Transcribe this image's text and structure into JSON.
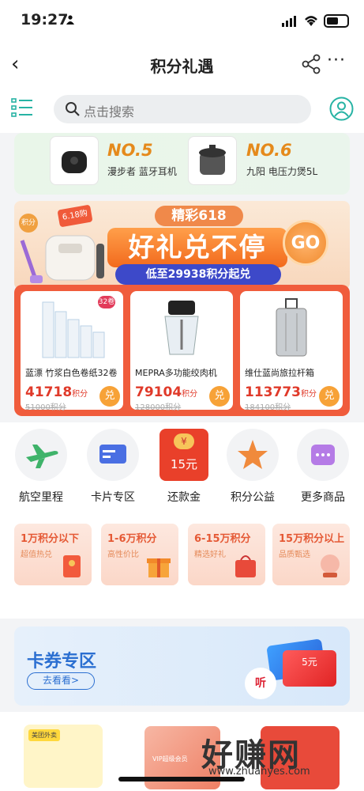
{
  "status": {
    "time": "19:27"
  },
  "nav": {
    "back": "‹",
    "title": "积分礼遇",
    "more": "···"
  },
  "search": {
    "placeholder": "点击搜索"
  },
  "top_products": [
    {
      "rank": "NO.5",
      "name": "漫步者 蓝牙耳机"
    },
    {
      "rank": "NO.6",
      "name": "九阳 电压力煲5L"
    }
  ],
  "banner": {
    "badge": "积分",
    "tag": "6.18购",
    "pill": "精彩618",
    "headline": "好礼兑不停",
    "sub": "低至29938积分起兑",
    "go": "GO"
  },
  "deals": [
    {
      "name": "蓝漂 竹浆白色卷纸32卷",
      "points": "41718",
      "unit": "积分",
      "old": "51000积分",
      "button": "兑",
      "badge": "32卷"
    },
    {
      "name": "MEPRA多功能绞肉机",
      "points": "79104",
      "unit": "积分",
      "old": "128000积分",
      "button": "兑"
    },
    {
      "name": "维仕蓝尚旅拉杆箱",
      "points": "113773",
      "unit": "积分",
      "old": "184100积分",
      "button": "兑"
    }
  ],
  "categories": [
    {
      "label": "航空里程",
      "icon": "airplane-icon"
    },
    {
      "label": "卡片专区",
      "icon": "card-icon"
    },
    {
      "label": "还款金",
      "icon": "red-packet-icon",
      "packet_symbol": "¥",
      "packet_value": "15元"
    },
    {
      "label": "积分公益",
      "icon": "star-icon"
    },
    {
      "label": "更多商品",
      "icon": "more-dots-icon"
    }
  ],
  "tiers": [
    {
      "title": "1万积分以下",
      "sub": "超值热兑"
    },
    {
      "title": "1-6万积分",
      "sub": "高性价比"
    },
    {
      "title": "6-15万积分",
      "sub": "精选好礼"
    },
    {
      "title": "15万积分以上",
      "sub": "品质甄选"
    }
  ],
  "coupon": {
    "title": "卡券专区",
    "cta": "去看看>",
    "card_text": "5元",
    "circle_text": "听"
  },
  "bottom": {
    "card1_label": "美团外卖",
    "card2_label": "VIP超级会员"
  },
  "watermark": {
    "brand": "好赚网",
    "url": "www.zhuanyes.com"
  },
  "colors": {
    "accent_orange": "#f05c3c",
    "coupon_blue": "#2b6fd1",
    "teal": "#27b3a4"
  }
}
